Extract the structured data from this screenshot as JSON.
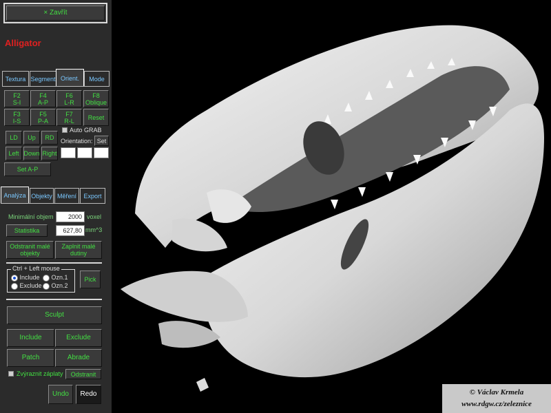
{
  "window": {
    "close_label": "× Zavřít",
    "title": "Alligator",
    "title_color": "#e02020"
  },
  "top_tabs": [
    "Textura",
    "Segment",
    "Orient.",
    "Mode"
  ],
  "orient": {
    "view_buttons": [
      [
        "F2\nS-I",
        "F4\nA-P",
        "F6\nL-R",
        "F8\nOblique"
      ],
      [
        "F3\nI-S",
        "F5\nP-A",
        "F7\nR-L",
        "Reset"
      ]
    ],
    "move_buttons": [
      "LD",
      "Up",
      "RD",
      "Left",
      "Down",
      "Right"
    ],
    "auto_grab_label": "Auto GRAB",
    "orientation_label": "Orientation:",
    "set_label": "Set",
    "set_ap_label": "Set A-P"
  },
  "bottom_tabs": [
    "Analýza",
    "Objekty",
    "Měření",
    "Export"
  ],
  "analysis": {
    "min_volume_label": "Minimální objem",
    "min_volume_value": "2000",
    "min_volume_unit": "voxel",
    "stats_label": "Statistika",
    "stats_value": "627,80",
    "stats_unit": "mm^3",
    "remove_small_label": "Odstranit malé\nobjekty",
    "fill_small_label": "Zaplnit malé\ndutiny",
    "group_label": "Ctrl + Left mouse",
    "radio_include": "Include",
    "radio_exclude": "Exclude",
    "radio_ozn1": "Ozn.1",
    "radio_ozn2": "Ozn.2",
    "pick_label": "Pick",
    "sculpt_label": "Sculpt",
    "include_label": "Include",
    "exclude_label": "Exclude",
    "patch_label": "Patch",
    "abrade_label": "Abrade",
    "highlight_label": "Zvýraznit záplaty",
    "remove_label": "Odstranit",
    "undo_label": "Undo",
    "redo_label": "Redo"
  },
  "credit": {
    "line1": "© Václav Krmela",
    "line2": "www.rdgw.cz/zeleznice"
  },
  "colors": {
    "panel": "#2b2b2b",
    "button_text": "#43e043",
    "tab_text": "#7bc8ff"
  }
}
